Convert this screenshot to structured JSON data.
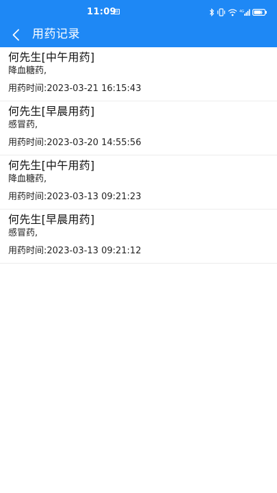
{
  "status": {
    "time": "11:09"
  },
  "header": {
    "title": "用药记录",
    "back_icon": "chevron-left-icon"
  },
  "colors": {
    "accent": "#1e88f5",
    "divider": "#ececec"
  },
  "records": [
    {
      "title": "何先生[中午用药]",
      "drug": "降血糖药,",
      "time_label": "用药时间:",
      "time_value": "2023-03-21 16:15:43"
    },
    {
      "title": "何先生[早晨用药]",
      "drug": "感冒药,",
      "time_label": "用药时间:",
      "time_value": "2023-03-20 14:55:56"
    },
    {
      "title": "何先生[中午用药]",
      "drug": "降血糖药,",
      "time_label": "用药时间:",
      "time_value": "2023-03-13 09:21:23"
    },
    {
      "title": "何先生[早晨用药]",
      "drug": "感冒药,",
      "time_label": "用药时间:",
      "time_value": "2023-03-13 09:21:12"
    }
  ]
}
